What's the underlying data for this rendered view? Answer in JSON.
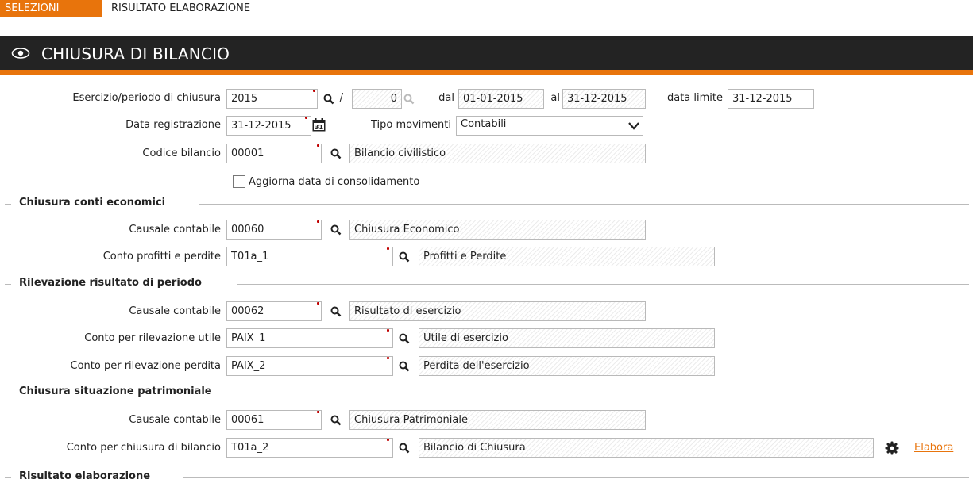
{
  "tabs": [
    {
      "label": "SELEZIONI",
      "active": true
    },
    {
      "label": "RISULTATO ELABORAZIONE",
      "active": false
    }
  ],
  "header": {
    "title": "CHIUSURA DI BILANCIO",
    "icon": "eye-icon"
  },
  "colors": {
    "accent": "#e8740c",
    "header_bg": "#232323",
    "required": "#c00000"
  },
  "form": {
    "esercizio_label": "Esercizio/periodo di chiusura",
    "esercizio_value": "2015",
    "slash": "/",
    "periodo_value": "0",
    "dal_label": "dal",
    "dal_value": "01-01-2015",
    "al_label": "al",
    "al_value": "31-12-2015",
    "data_limite_label": "data limite",
    "data_limite_value": "31-12-2015",
    "data_reg_label": "Data registrazione",
    "data_reg_value": "31-12-2015",
    "tipo_mov_label": "Tipo movimenti",
    "tipo_mov_value": "Contabili",
    "codice_label": "Codice bilancio",
    "codice_value": "00001",
    "codice_desc": "Bilancio civilistico",
    "aggiorna_label": "Aggiorna data di consolidamento",
    "aggiorna_checked": false
  },
  "sections": {
    "economici": {
      "title": "Chiusura conti economici",
      "causale_label": "Causale contabile",
      "causale_value": "00060",
      "causale_desc": "Chiusura Economico",
      "conto_label": "Conto profitti e perdite",
      "conto_value": "T01a_1",
      "conto_desc": "Profitti e Perdite"
    },
    "risultato_periodo": {
      "title": "Rilevazione risultato di periodo",
      "causale_label": "Causale contabile",
      "causale_value": "00062",
      "causale_desc": "Risultato di esercizio",
      "utile_label": "Conto per rilevazione utile",
      "utile_value": "PAIX_1",
      "utile_desc": "Utile di esercizio",
      "perdita_label": "Conto per rilevazione perdita",
      "perdita_value": "PAIX_2",
      "perdita_desc": "Perdita dell'esercizio"
    },
    "patrimoniale": {
      "title": "Chiusura situazione patrimoniale",
      "causale_label": "Causale contabile",
      "causale_value": "00061",
      "causale_desc": "Chiusura Patrimoniale",
      "conto_label": "Conto per chiusura di bilancio",
      "conto_value": "T01a_2",
      "conto_desc": "Bilancio di Chiusura"
    },
    "risultato": {
      "title": "Risultato elaborazione"
    }
  },
  "actions": {
    "elabora_label": "Elabora",
    "gear_icon": "gear-icon"
  }
}
